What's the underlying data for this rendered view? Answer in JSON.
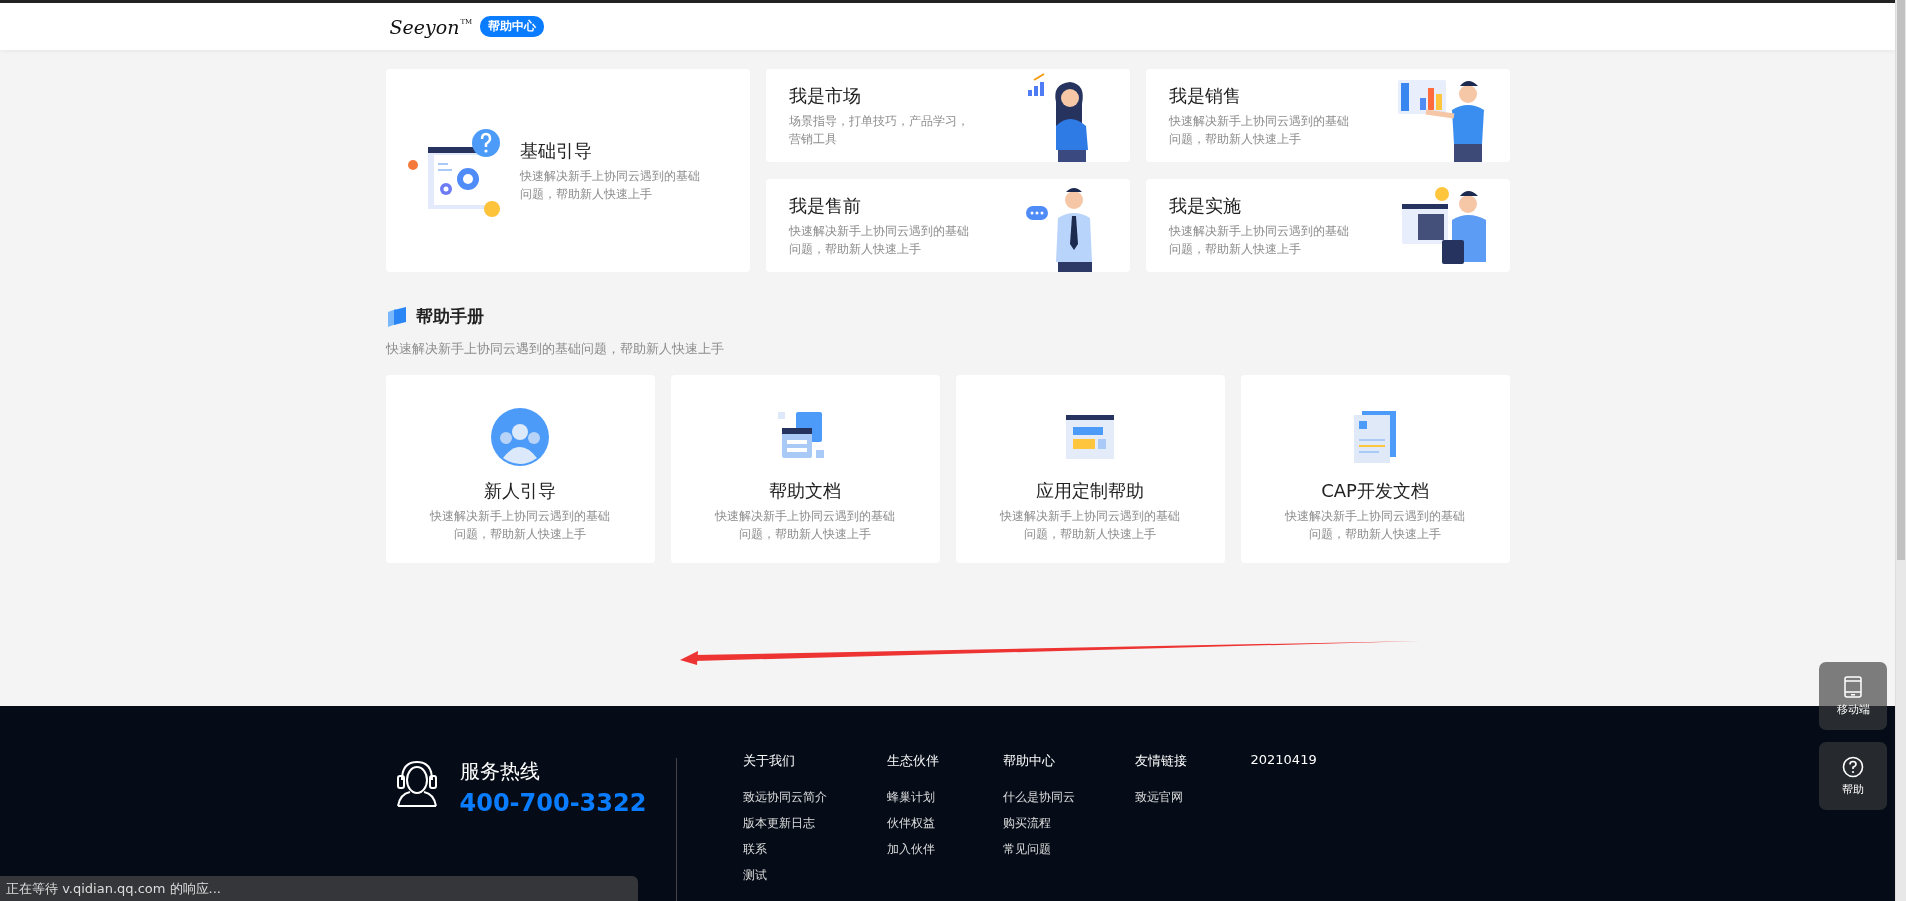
{
  "header": {
    "logo": {
      "text": "Seeyon",
      "mark": "TM"
    },
    "badge": "帮助中心"
  },
  "guide_cards": [
    {
      "kind": "featured",
      "title": "基础引导",
      "description": "快速解决新手上协同云遇到的基础问题，帮助新人快速上手"
    },
    {
      "kind": "role",
      "title": "我是市场",
      "description": "场景指导，打单技巧，产品学习，营销工具"
    },
    {
      "kind": "role",
      "title": "我是销售",
      "description": "快速解决新手上协同云遇到的基础问题，帮助新人快速上手"
    },
    {
      "kind": "role",
      "title": "我是售前",
      "description": "快速解决新手上协同云遇到的基础问题，帮助新人快速上手"
    },
    {
      "kind": "role",
      "title": "我是实施",
      "description": "快速解决新手上协同云遇到的基础问题，帮助新人快速上手"
    }
  ],
  "manual": {
    "title": "帮助手册",
    "subtitle": "快速解决新手上协同云遇到的基础问题，帮助新人快速上手",
    "cards": [
      {
        "title": "新人引导",
        "description": "快速解决新手上协同云遇到的基础问题，帮助新人快速上手"
      },
      {
        "title": "帮助文档",
        "description": "快速解决新手上协同云遇到的基础问题，帮助新人快速上手"
      },
      {
        "title": "应用定制帮助",
        "description": "快速解决新手上协同云遇到的基础问题，帮助新人快速上手"
      },
      {
        "title": "CAP开发文档",
        "description": "快速解决新手上协同云遇到的基础问题，帮助新人快速上手"
      }
    ]
  },
  "footer": {
    "hotline_label": "服务热线",
    "hotline_number": "400-700-3322",
    "columns": [
      {
        "heading": "关于我们",
        "links": [
          "致远协同云简介",
          "版本更新日志",
          "联系",
          "测试"
        ]
      },
      {
        "heading": "生态伙伴",
        "links": [
          "蜂巢计划",
          "伙伴权益",
          "加入伙伴"
        ]
      },
      {
        "heading": "帮助中心",
        "links": [
          "什么是协同云",
          "购买流程",
          "常见问题"
        ]
      },
      {
        "heading": "友情链接",
        "links": [
          "致远官网"
        ]
      },
      {
        "heading": "20210419"
      }
    ]
  },
  "float_buttons": [
    {
      "kind": "mobile",
      "label": "移动端"
    },
    {
      "kind": "help",
      "label": "帮助"
    }
  ],
  "status_bar": "正在等待 v.qidian.qq.com 的响应..."
}
